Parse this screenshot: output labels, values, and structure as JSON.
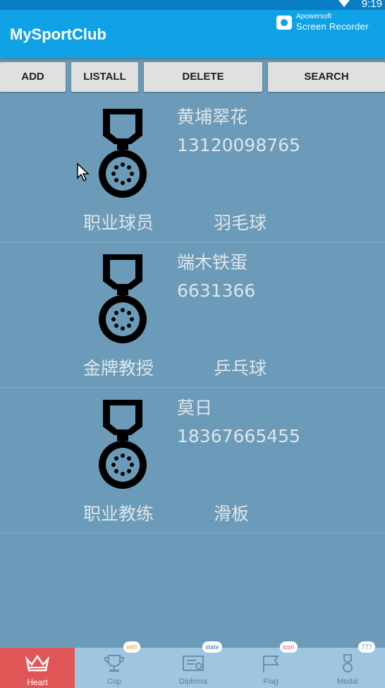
{
  "status_bar": {
    "time": "9:19"
  },
  "app_bar": {
    "title": "MySportClub"
  },
  "watermark": {
    "line1": "Apowersoft",
    "line2": "Screen Recorder"
  },
  "toolbar": {
    "add": "ADD",
    "listall": "LISTALL",
    "delete": "DELETE",
    "search": "SEARCH"
  },
  "members": [
    {
      "name": "黄埔翠花",
      "phone": "13120098765",
      "role": "职业球员",
      "sport": "羽毛球",
      "icon": "medal-icon"
    },
    {
      "name": "端木铁蛋",
      "phone": "6631366",
      "role": "金牌教授",
      "sport": "乒乓球",
      "icon": "medal-icon"
    },
    {
      "name": "莫日",
      "phone": "18367665455",
      "role": "职业教练",
      "sport": "滑板",
      "icon": "medal-icon"
    }
  ],
  "bottom_nav": {
    "tabs": [
      {
        "label": "Heart",
        "icon": "crown-icon",
        "active": true
      },
      {
        "label": "Cup",
        "icon": "trophy-icon",
        "badge": "with"
      },
      {
        "label": "Diploma",
        "icon": "diploma-icon",
        "badge": "state"
      },
      {
        "label": "Flag",
        "icon": "flag-icon",
        "badge": "icon"
      },
      {
        "label": "Medal",
        "icon": "medal-icon",
        "badge": "777"
      }
    ]
  },
  "colors": {
    "background": "#6b9bb8",
    "app_bar": "#10a2e6",
    "status_bar": "#0a7ec4",
    "active_tab": "#e05656",
    "badge_with": "#f0a030",
    "badge_state": "#3a78c8",
    "badge_icon": "#e04a8a",
    "badge_777": "#40a0c8"
  }
}
